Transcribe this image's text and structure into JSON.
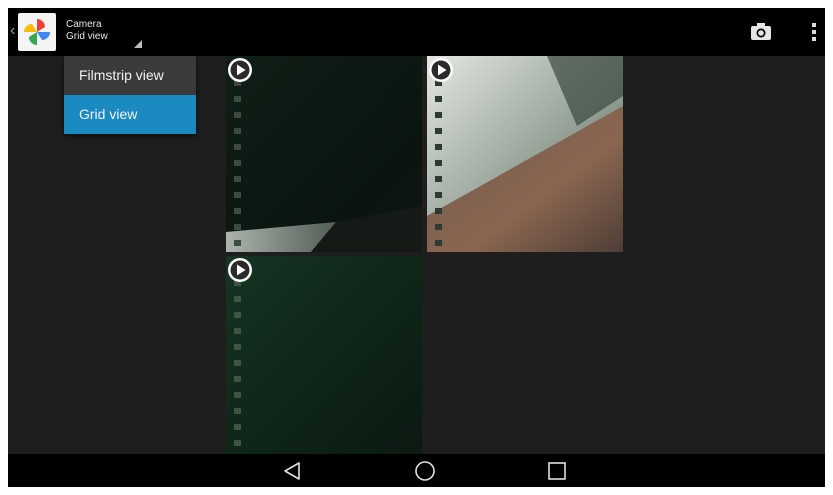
{
  "actionbar": {
    "title": "Camera",
    "subtitle": "Grid view",
    "back_icon": "chevron-left-icon",
    "app_icon": "photos-pinwheel-icon",
    "camera_icon": "camera-icon",
    "overflow_icon": "overflow-menu-icon"
  },
  "view_menu": {
    "items": [
      {
        "label": "Filmstrip view",
        "selected": false
      },
      {
        "label": "Grid view",
        "selected": true
      }
    ]
  },
  "grid": {
    "items": [
      {
        "type": "video",
        "icon": "play-icon"
      },
      {
        "type": "video",
        "icon": "play-icon"
      },
      {
        "type": "video",
        "icon": "play-icon"
      }
    ]
  },
  "navbar": {
    "back_icon": "nav-back-icon",
    "home_icon": "nav-home-icon",
    "recents_icon": "nav-recents-icon"
  },
  "colors": {
    "accent": "#1a8ac0",
    "background": "#1e1e1e",
    "bar": "#000000"
  }
}
